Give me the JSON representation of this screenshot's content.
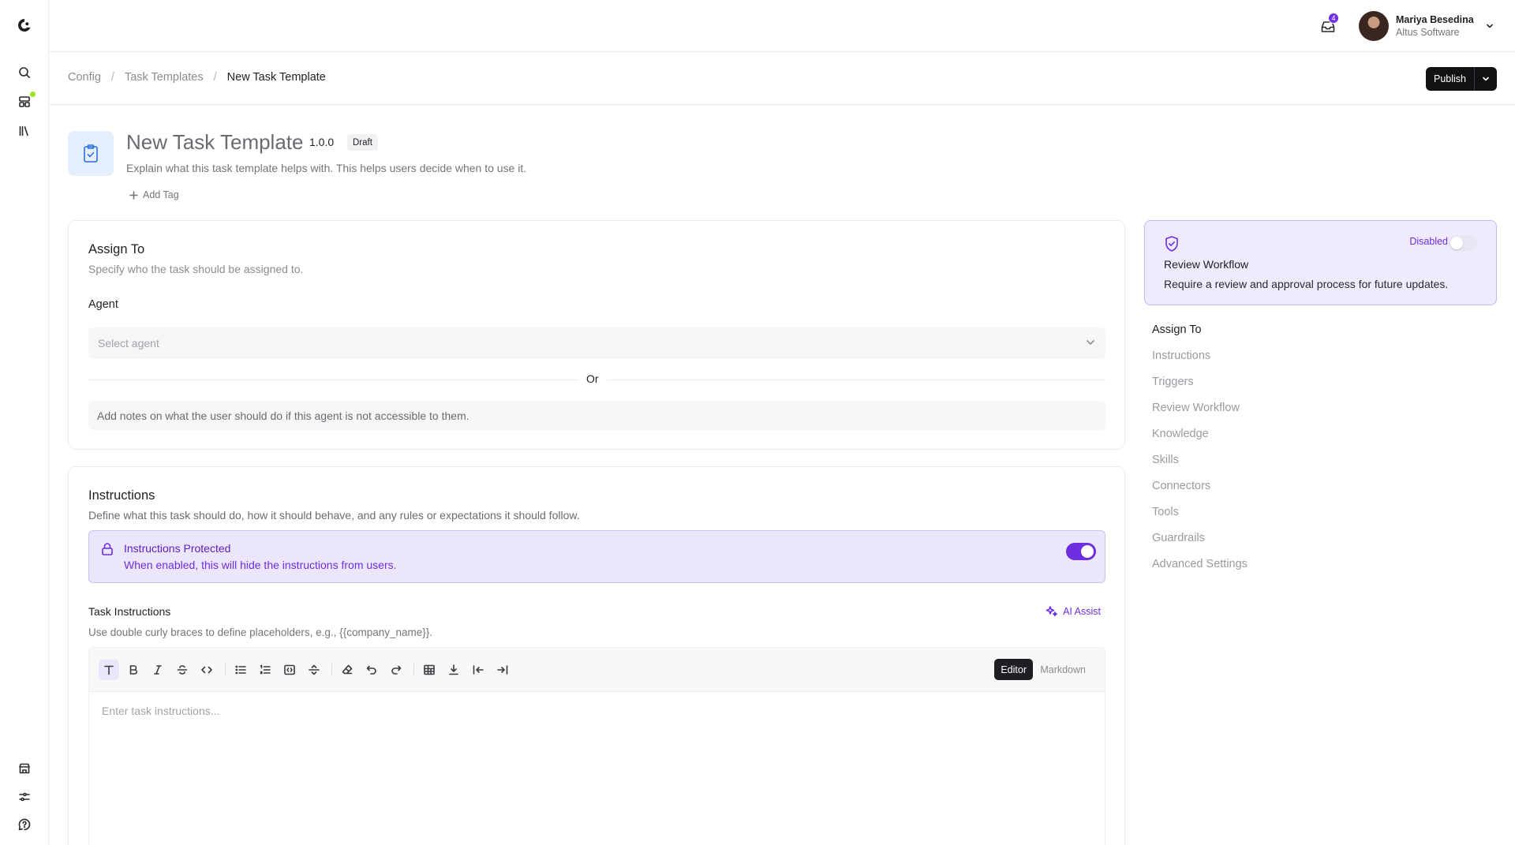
{
  "header": {
    "notifications_count": "4",
    "user_name": "Mariya Besedina",
    "user_org": "Altus Software"
  },
  "breadcrumb": {
    "items": [
      "Config",
      "Task Templates"
    ],
    "current": "New Task Template",
    "separator": "/"
  },
  "actions": {
    "publish_label": "Publish"
  },
  "template": {
    "title": "New Task Template",
    "version": "1.0.0",
    "status": "Draft",
    "description": "Explain what this task template helps with. This helps users decide when to use it.",
    "add_tag_label": "Add Tag"
  },
  "assign_to": {
    "title": "Assign To",
    "subtitle": "Specify who the task should be assigned to.",
    "agent_label": "Agent",
    "agent_placeholder": "Select agent",
    "or_label": "Or",
    "notes_placeholder": "Add notes on what the user should do if this agent is not accessible to them."
  },
  "instructions": {
    "title": "Instructions",
    "subtitle": "Define what this task should do, how it should behave, and any rules or expectations it should follow.",
    "protected_title": "Instructions Protected",
    "protected_desc": "When enabled, this will hide the instructions from users.",
    "protected_enabled": true,
    "task_instructions_label": "Task Instructions",
    "task_instructions_help": "Use double curly braces to define placeholders, e.g., {{company_name}}.",
    "ai_assist_label": "AI Assist",
    "mode_editor": "Editor",
    "mode_markdown": "Markdown",
    "editor_placeholder": "Enter task instructions..."
  },
  "review_workflow": {
    "status": "Disabled",
    "enabled": false,
    "title": "Review Workflow",
    "description": "Require a review and approval process for future updates."
  },
  "toc": {
    "items": [
      "Assign To",
      "Instructions",
      "Triggers",
      "Review Workflow",
      "Knowledge",
      "Skills",
      "Connectors",
      "Tools",
      "Guardrails",
      "Advanced Settings"
    ],
    "active": "Assign To"
  },
  "colors": {
    "accent": "#6d2ee0",
    "accent_soft": "#ece6fc",
    "template_icon": "#2c6fe0",
    "online_dot": "#9be21f"
  },
  "icons": {
    "rail_top": [
      "logo-icon",
      "search-icon",
      "templates-icon",
      "library-icon"
    ],
    "rail_bottom": [
      "store-icon",
      "settings-sliders-icon",
      "help-icon"
    ],
    "toolbar": [
      "text-style-icon",
      "bold-icon",
      "italic-icon",
      "strikethrough-icon",
      "code-icon",
      "bullet-list-icon",
      "numbered-list-icon",
      "code-block-icon",
      "horizontal-rule-icon",
      "clear-format-icon",
      "undo-icon",
      "redo-icon",
      "table-icon",
      "insert-below-icon",
      "outdent-icon",
      "indent-icon"
    ]
  }
}
